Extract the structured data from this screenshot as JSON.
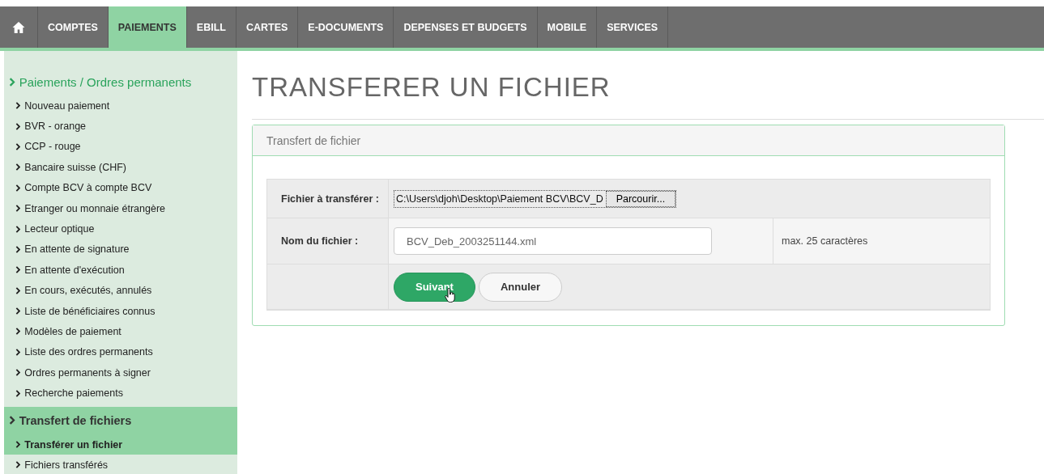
{
  "nav": [
    {
      "label": "COMPTES",
      "selected": false
    },
    {
      "label": "PAIEMENTS",
      "selected": true
    },
    {
      "label": "EBILL",
      "selected": false
    },
    {
      "label": "CARTES",
      "selected": false
    },
    {
      "label": "E-DOCUMENTS",
      "selected": false
    },
    {
      "label": "DEPENSES ET BUDGETS",
      "selected": false
    },
    {
      "label": "MOBILE",
      "selected": false
    },
    {
      "label": "SERVICES",
      "selected": false
    }
  ],
  "sidebar": [
    {
      "title": "Paiements / Ordres permanents",
      "selected": false,
      "items": [
        {
          "label": "Nouveau paiement",
          "selected": false
        },
        {
          "label": "BVR - orange",
          "selected": false
        },
        {
          "label": "CCP - rouge",
          "selected": false
        },
        {
          "label": "Bancaire suisse (CHF)",
          "selected": false
        },
        {
          "label": "Compte BCV à compte BCV",
          "selected": false
        },
        {
          "label": "Etranger ou monnaie étrangère",
          "selected": false
        },
        {
          "label": "Lecteur optique",
          "selected": false
        },
        {
          "label": "En attente de signature",
          "selected": false
        },
        {
          "label": "En attente d'exécution",
          "selected": false
        },
        {
          "label": "En cours, exécutés, annulés",
          "selected": false
        },
        {
          "label": "Liste de bénéficiaires connus",
          "selected": false
        },
        {
          "label": "Modèles de paiement",
          "selected": false
        },
        {
          "label": "Liste des ordres permanents",
          "selected": false
        },
        {
          "label": "Ordres permanents à signer",
          "selected": false
        },
        {
          "label": "Recherche paiements",
          "selected": false
        }
      ]
    },
    {
      "title": "Transfert de fichiers",
      "selected": true,
      "items": [
        {
          "label": "Transférer un fichier",
          "selected": true
        },
        {
          "label": "Fichiers transférés",
          "selected": false
        }
      ]
    }
  ],
  "page_title": "TRANSFERER UN FICHIER",
  "panel": {
    "title": "Transfert de fichier",
    "rows": [
      {
        "kind": "file",
        "label": "Fichier à transférer :",
        "value": "C:\\Users\\djoh\\Desktop\\Paiement BCV\\BCV_D",
        "button": "Parcourir..."
      },
      {
        "kind": "text",
        "label": "Nom du fichier :",
        "value": "BCV_Deb_2003251144.xml",
        "hint": "max. 25 caractères"
      },
      {
        "kind": "actions",
        "primary": "Suivant",
        "secondary": "Annuler"
      }
    ]
  }
}
